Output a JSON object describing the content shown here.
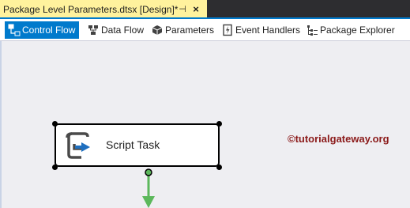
{
  "document_tab": {
    "title": "Package Level Parameters.dtsx [Design]*",
    "pin_glyph": "⊣",
    "close_glyph": "×"
  },
  "designer_tabs": [
    {
      "label": "Control Flow",
      "icon": "control-flow-icon",
      "active": true
    },
    {
      "label": "Data Flow",
      "icon": "data-flow-icon",
      "active": false
    },
    {
      "label": "Parameters",
      "icon": "parameters-icon",
      "active": false
    },
    {
      "label": "Event Handlers",
      "icon": "event-handlers-icon",
      "active": false
    },
    {
      "label": "Package Explorer",
      "icon": "package-explorer-icon",
      "active": false
    }
  ],
  "canvas": {
    "task": {
      "label": "Script Task",
      "icon": "script-task-icon"
    },
    "watermark": "©tutorialgateway.org"
  },
  "colors": {
    "tab_strip": "#2d2d30",
    "doc_tab": "#fff29d",
    "accent": "#007acc",
    "canvas": "#eeeef2",
    "connector": "#5cb85c",
    "watermark": "#8b1a1a"
  }
}
